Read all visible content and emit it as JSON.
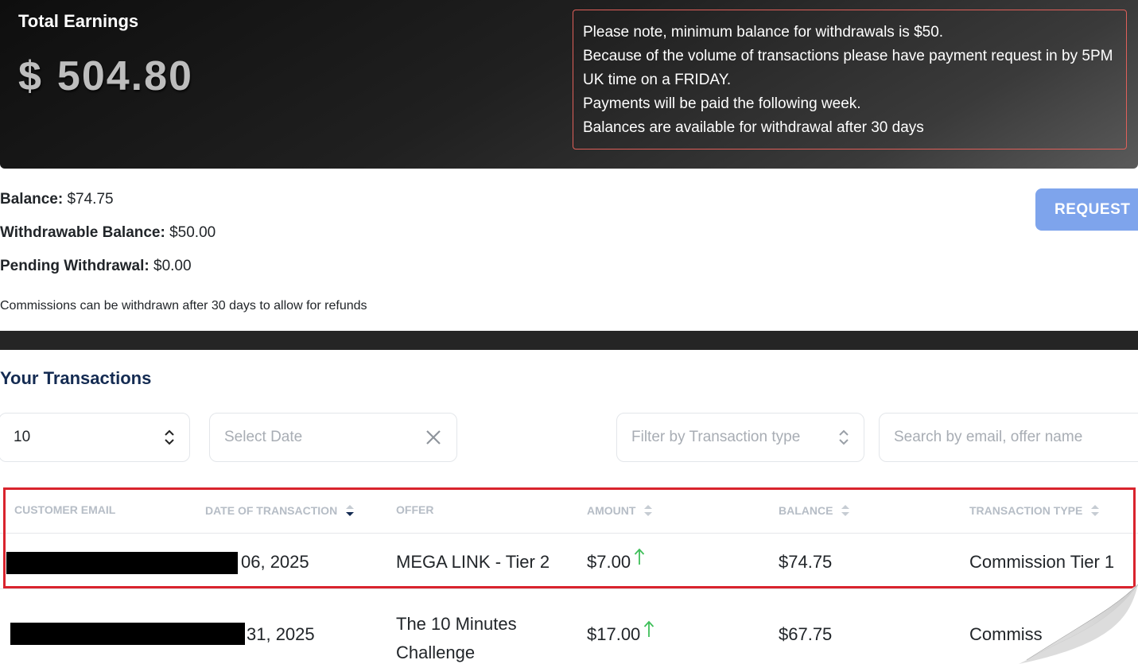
{
  "hero": {
    "title": "Total Earnings",
    "currency": "$",
    "amount": "504.80"
  },
  "notice": {
    "lines": [
      "Please note, minimum balance for withdrawals is $50.",
      "Because of the volume of transactions please have payment request in by 5PM UK time on a FRIDAY.",
      "Payments will be paid the following week.",
      "Balances are available for withdrawal after 30 days"
    ],
    "border_color": "#e0605a"
  },
  "balances": {
    "balance_label": "Balance:",
    "balance_value": "$74.75",
    "withdrawable_label": "Withdrawable Balance:",
    "withdrawable_value": "$50.00",
    "pending_label": "Pending Withdrawal:",
    "pending_value": "$0.00",
    "note": "Commissions can be withdrawn after 30 days to allow for refunds"
  },
  "request_button": {
    "label": "REQUEST",
    "color": "#7ea4ec"
  },
  "transactions": {
    "title": "Your Transactions",
    "page_size": "10",
    "date_placeholder": "Select Date",
    "type_placeholder": "Filter by Transaction type",
    "search_placeholder": "Search by email, offer name",
    "columns": [
      "CUSTOMER EMAIL",
      "DATE OF TRANSACTION",
      "OFFER",
      "AMOUNT",
      "BALANCE",
      "TRANSACTION TYPE"
    ],
    "rows": [
      {
        "date": "06, 2025",
        "offer": "MEGA LINK - Tier 2",
        "amount": "$7.00",
        "balance": "$74.75",
        "type": "Commission Tier 1"
      },
      {
        "date": "31, 2025",
        "offer_line1": "The 10 Minutes",
        "offer_line2": "Challenge",
        "amount": "$17.00",
        "balance": "$67.75",
        "type": "Commiss"
      }
    ],
    "highlight_color": "#d9232d",
    "arrow_color": "#3fbf5a"
  }
}
